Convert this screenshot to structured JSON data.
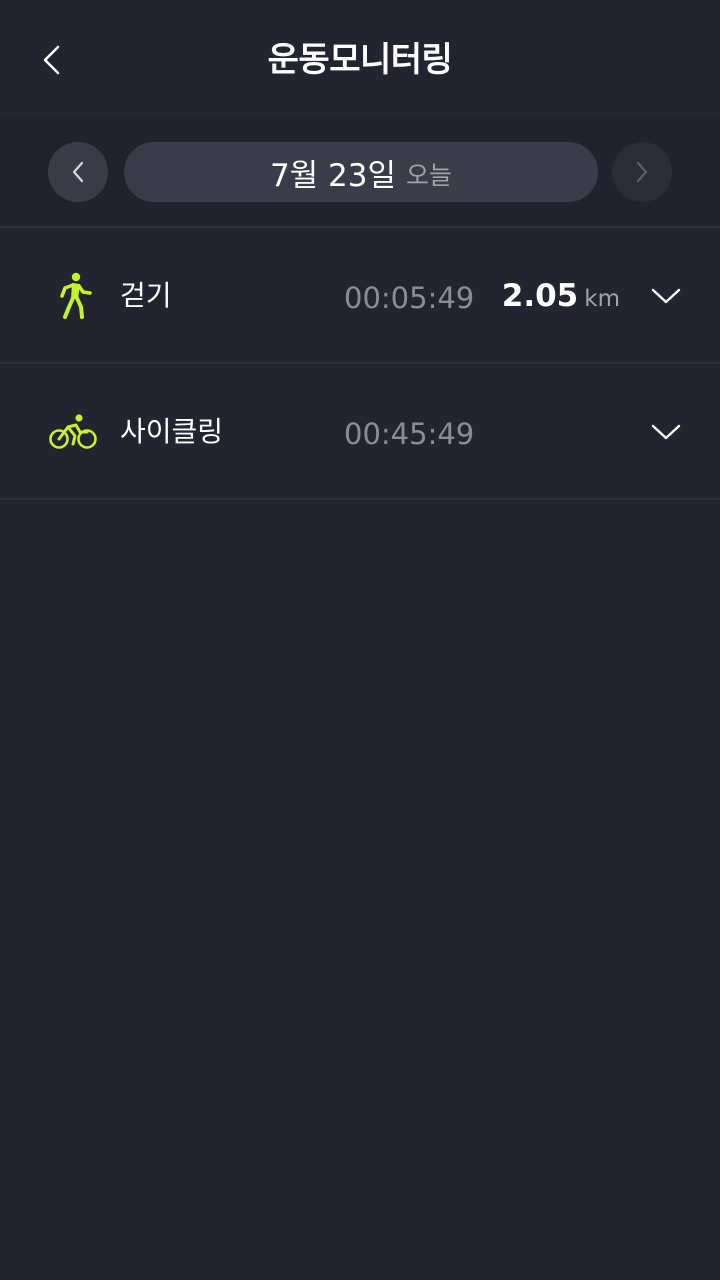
{
  "header": {
    "title": "운동모니터링",
    "back_icon": "chevron-left-icon"
  },
  "date_nav": {
    "prev_icon": "chevron-left-icon",
    "next_icon": "chevron-right-icon",
    "date": "7월 23일",
    "relative": "오늘"
  },
  "activities": [
    {
      "name": "걷기",
      "icon": "walking-icon",
      "duration": "00:05:49",
      "distance": "2.05",
      "unit": "km"
    },
    {
      "name": "사이클링",
      "icon": "cycling-icon",
      "duration": "00:45:49",
      "distance": "",
      "unit": ""
    }
  ],
  "colors": {
    "background": "#22242f",
    "accent": "#c5f22a",
    "pill": "#3a3d49",
    "muted_text": "#8a8d97"
  }
}
